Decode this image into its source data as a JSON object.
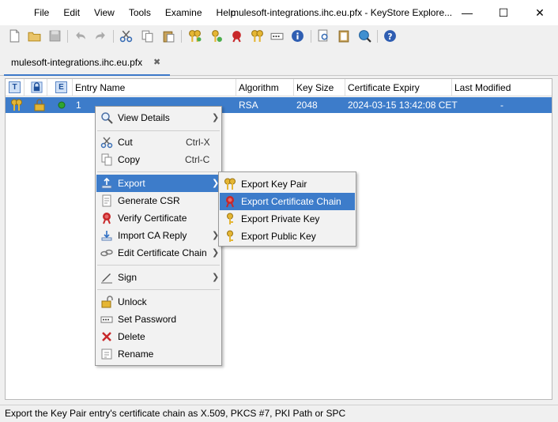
{
  "menubar": [
    "File",
    "Edit",
    "View",
    "Tools",
    "Examine",
    "Help"
  ],
  "window": {
    "title": "mulesoft-integrations.ihc.eu.pfx - KeyStore Explore...",
    "minimize": "—",
    "maximize": "☐",
    "close": "✕"
  },
  "tab": {
    "label": "mulesoft-integrations.ihc.eu.pfx",
    "close": "✖"
  },
  "table": {
    "badges": [
      "T",
      "",
      "E"
    ],
    "columns": [
      "Entry Name",
      "Algorithm",
      "Key Size",
      "Certificate Expiry",
      "Last Modified"
    ],
    "rows": [
      {
        "entry_name": "1",
        "algorithm": "RSA",
        "key_size": "2048",
        "certificate_expiry": "2024-03-15 13:42:08 CET",
        "last_modified": "-"
      }
    ]
  },
  "context_menu": {
    "view_details": "View Details",
    "cut": "Cut",
    "cut_shortcut": "Ctrl-X",
    "copy": "Copy",
    "copy_shortcut": "Ctrl-C",
    "export": "Export",
    "generate_csr": "Generate CSR",
    "verify_certificate": "Verify Certificate",
    "import_ca_reply": "Import CA Reply",
    "edit_certificate_chain": "Edit Certificate Chain",
    "sign": "Sign",
    "unlock": "Unlock",
    "set_password": "Set Password",
    "delete": "Delete",
    "rename": "Rename"
  },
  "export_submenu": {
    "export_key_pair": "Export Key Pair",
    "export_certificate_chain": "Export Certificate Chain",
    "export_private_key": "Export Private Key",
    "export_public_key": "Export Public Key"
  },
  "status": "Export the Key Pair entry's certificate chain as X.509, PKCS #7, PKI Path or SPC",
  "colors": {
    "selection": "#3d7cca",
    "accent": "#3c78c8"
  }
}
